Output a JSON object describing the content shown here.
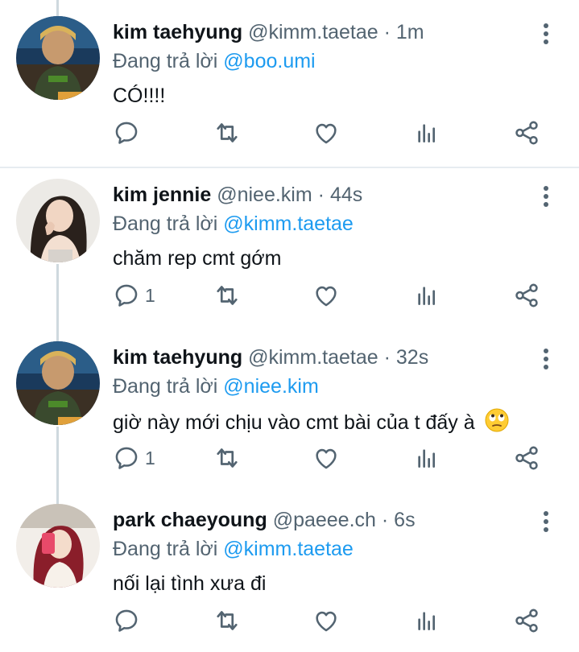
{
  "reply_prefix": "Đang trả lời",
  "tweets": [
    {
      "name": "kim taehyung",
      "handle": "@kimm.taetae",
      "separator": "·",
      "time": "1m",
      "reply_to": "@boo.umi",
      "text": "CÓ!!!!",
      "reply_count": ""
    },
    {
      "name": "kim jennie",
      "handle": "@niee.kim",
      "separator": "·",
      "time": "44s",
      "reply_to": "@kimm.taetae",
      "text": "chăm rep cmt gớm",
      "reply_count": "1"
    },
    {
      "name": "kim taehyung",
      "handle": "@kimm.taetae",
      "separator": "·",
      "time": "32s",
      "reply_to": "@niee.kim",
      "text": "giờ này mới chịu vào cmt bài của t đấy à",
      "reply_count": "1"
    },
    {
      "name": "park chaeyoung",
      "handle": "@paeee.ch",
      "separator": "·",
      "time": "6s",
      "reply_to": "@kimm.taetae",
      "text": "nối lại tình xưa đi",
      "reply_count": ""
    }
  ],
  "colors": {
    "accent": "#1d9bf0",
    "muted": "#536471",
    "text": "#0f1419",
    "divider": "#e6ecf0"
  },
  "icons": [
    "reply-icon",
    "retweet-icon",
    "like-icon",
    "analytics-icon",
    "share-icon",
    "more-icon",
    "eye-roll-emoji"
  ]
}
